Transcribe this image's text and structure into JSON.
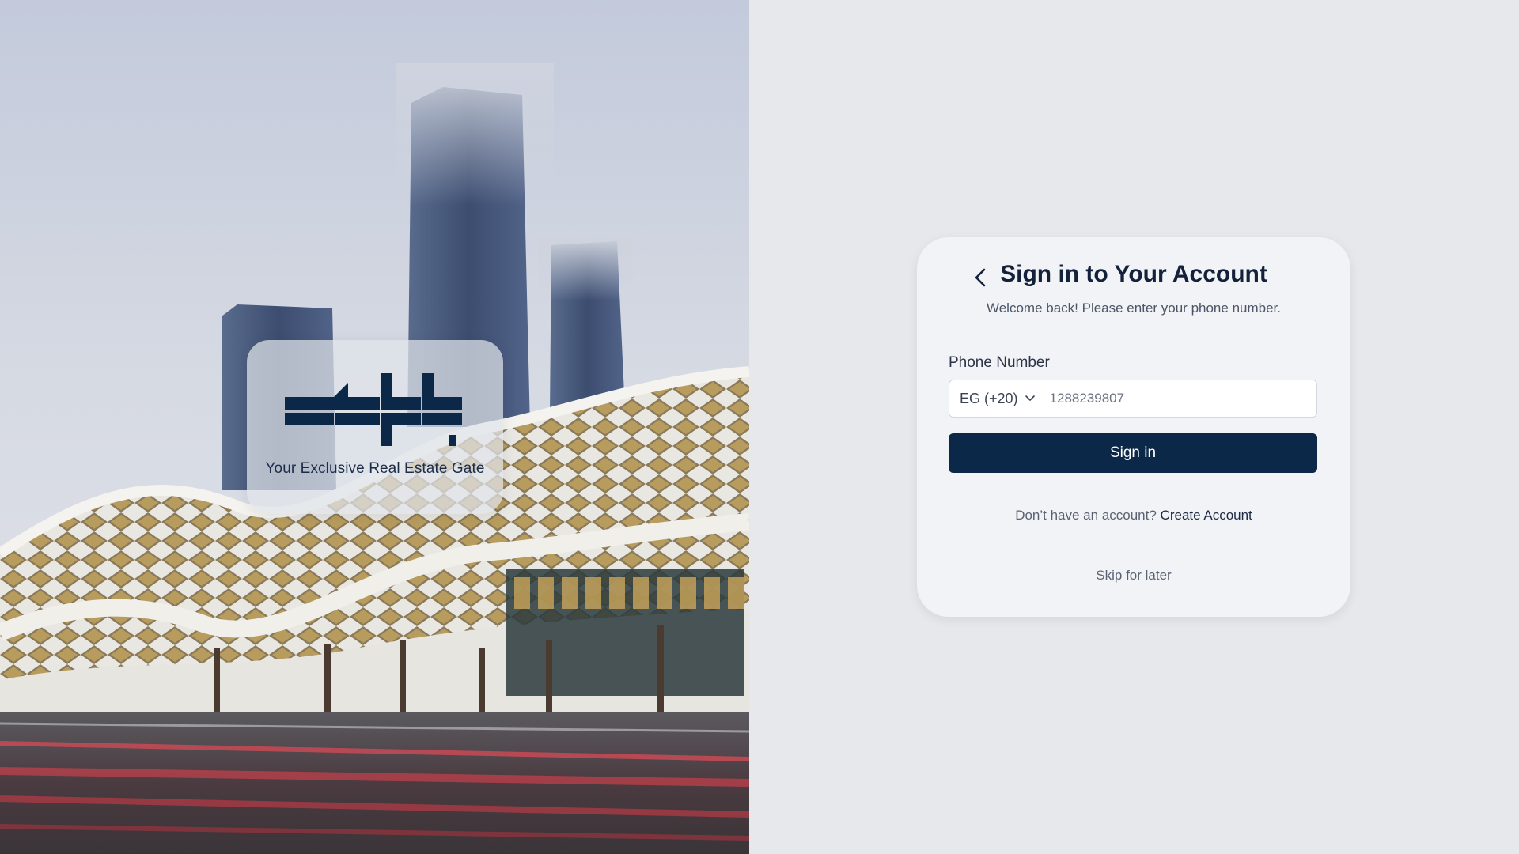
{
  "hero": {
    "tagline": "Your Exclusive Real Estate Gate"
  },
  "signin": {
    "title": "Sign in to Your Account",
    "subtitle": "Welcome back! Please enter your phone number.",
    "phone_label": "Phone Number",
    "country_code": "EG (+20)",
    "phone_value": "1288239807",
    "submit_label": "Sign in",
    "no_account_text": "Don’t have an account?",
    "create_account_label": "Create Account",
    "skip_label": "Skip for later"
  },
  "icons": {
    "back": "chevron-left-icon",
    "country_dropdown": "chevron-down-icon"
  },
  "colors": {
    "primary": "#0c2848",
    "card_background": "#f2f3f6",
    "page_background": "#e6e8ec"
  }
}
